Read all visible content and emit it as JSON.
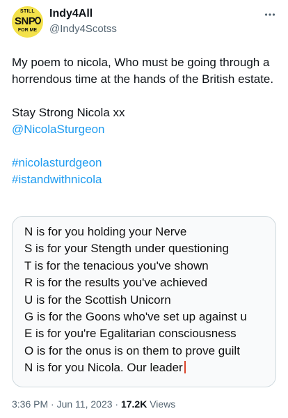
{
  "author": {
    "avatar_text_top": "STILL",
    "avatar_text_mid": "SNP",
    "avatar_text_bottom": "FOR ME",
    "name": "Indy4All",
    "handle": "@Indy4Scotss",
    "more_icon": "more-icon"
  },
  "tweet": {
    "line1": "My poem to nicola, Who must be going through a horrendous time at the hands of the British estate.",
    "line2": "Stay Strong Nicola xx",
    "mention": "@NicolaSturgeon",
    "hashtag1": "#nicolasturdgeon",
    "hashtag2": "#istandwithnicola"
  },
  "poem": {
    "lines": [
      "N is for you holding your Nerve",
      "S is for your Stength under questioning",
      "T is for the tenacious you've shown",
      "R is for the results you've achieved",
      "U is for the Scottish Unicorn",
      "G is for the Goons who've set up against u",
      "E is for you're Egalitarian consciousness",
      "O is for the onus is on them to prove guilt",
      "N is for you Nicola. Our leader"
    ]
  },
  "meta": {
    "time": "3:36 PM",
    "separator": " · ",
    "date": "Jun 11, 2023",
    "views_count": "17.2K",
    "views_label": " Views"
  },
  "colors": {
    "link": "#1d9bf0",
    "secondary_text": "#536471",
    "card_border": "#cfd9de"
  }
}
